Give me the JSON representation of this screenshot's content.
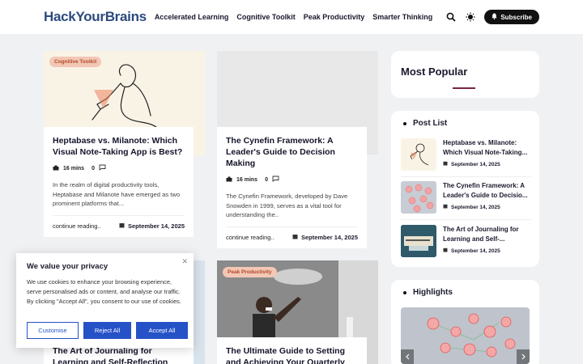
{
  "header": {
    "logo": "HackYourBrains",
    "nav": [
      "Accelerated Learning",
      "Cognitive Toolkit",
      "Peak Productivity",
      "Smarter Thinking"
    ],
    "subscribe_label": "Subscribe",
    "icons": [
      "search-icon",
      "theme-toggle-icon",
      "bell-icon"
    ]
  },
  "posts": [
    {
      "tag": "Cognitive Toolkit",
      "title": "Heptabase vs. Milanote: Which Visual Note-Taking App is Best?",
      "read_time": "16 mins",
      "comments": "0",
      "excerpt": "In the realm of digital productivity tools, Heptabase and Milanote have emerged as two prominent platforms that...",
      "read_more": "continue reading..",
      "date": "September 14, 2025"
    },
    {
      "tag": "",
      "title": "The Cynefin Framework: A Leader's Guide to Decision Making",
      "read_time": "16 mins",
      "comments": "0",
      "excerpt": "The Cynefin Framework, developed by Dave Snowden in 1999, serves as a vital tool for understanding the..",
      "read_more": "continue reading..",
      "date": "September 14, 2025"
    },
    {
      "tag": "",
      "title": "The Art of Journaling for Learning and Self-Reflection"
    },
    {
      "tag": "Peak Productivity",
      "title": "The Ultimate Guide to Setting and Achieving Your Quarterly"
    }
  ],
  "sidebar": {
    "most_popular_title": "Most Popular",
    "post_list_title": "Post List",
    "post_list": [
      {
        "title": "Heptabase vs. Milanote: Which Visual Note-Taking...",
        "date": "September 14, 2025"
      },
      {
        "title": "The Cynefin Framework: A Leader's Guide to Decisio...",
        "date": "September 14, 2025"
      },
      {
        "title": "The Art of Journaling for Learning and Self-...",
        "date": "September 14, 2025"
      }
    ],
    "highlights_title": "Highlights"
  },
  "cookie": {
    "title": "We value your privacy",
    "text": "We use cookies to enhance your browsing experience, serve personalised ads or content, and analyse our traffic. By clicking \"Accept All\", you consent to our use of cookies.",
    "customise": "Customise",
    "reject": "Reject All",
    "accept": "Accept All"
  },
  "colors": {
    "logo": "#2b4a7e",
    "accent_button": "#2552c7",
    "tag_bg": "#f3c7b5",
    "tag_text": "#b24a2a",
    "underline": "#7a2540"
  }
}
